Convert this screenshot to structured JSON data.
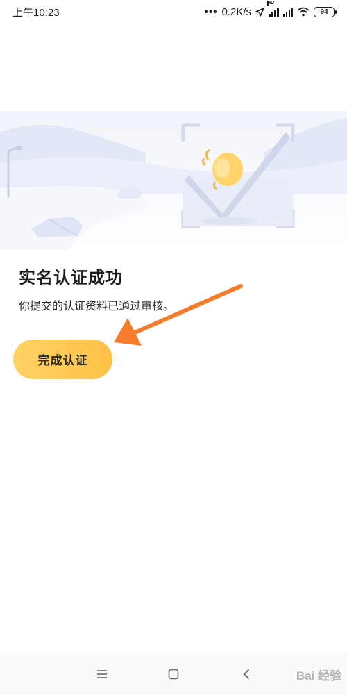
{
  "status_bar": {
    "time": "上午10:23",
    "dots": "•••",
    "network_speed": "0.2K/s",
    "hd_label": "HD",
    "battery": "94",
    "icons": [
      "location-arrow-icon",
      "signal-icon",
      "signal-icon",
      "wifi-icon",
      "battery-icon"
    ]
  },
  "hero": {
    "icon": "verification-success-illustration"
  },
  "content": {
    "title": "实名认证成功",
    "subtitle": "你提交的认证资料已通过审核。",
    "button_label": "完成认证"
  },
  "annotation": {
    "icon": "arrow-icon",
    "color": "#f47c2a"
  },
  "nav_bar": {
    "icons": [
      "menu-icon",
      "home-square-icon",
      "back-chevron-icon"
    ],
    "watermark": "Bai 经验"
  },
  "colors": {
    "button_start": "#ffd264",
    "button_end": "#ffc148",
    "hero_accent": "#dde3f4"
  }
}
